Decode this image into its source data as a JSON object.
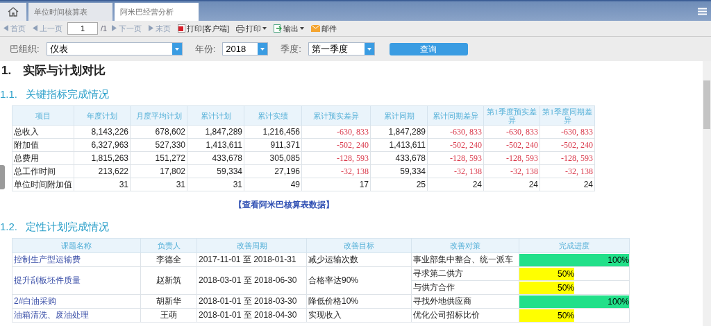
{
  "tabs": [
    {
      "label": "单位时间核算表",
      "selected": false
    },
    {
      "label": "阿米巴经营分析",
      "selected": true
    }
  ],
  "toolbar": [
    {
      "kind": "first",
      "label": "首页",
      "disabled": true
    },
    {
      "kind": "prev",
      "label": "上一页",
      "disabled": true
    },
    {
      "kind": "page",
      "value": "1",
      "total": "/1"
    },
    {
      "kind": "next",
      "label": "下一页",
      "disabled": true
    },
    {
      "kind": "last",
      "label": "末页",
      "disabled": true
    },
    {
      "kind": "pdf",
      "label": "打印[客户端]",
      "disabled": false
    },
    {
      "kind": "print",
      "label": "打印",
      "disabled": false
    },
    {
      "kind": "export",
      "label": "输出",
      "disabled": false
    },
    {
      "kind": "mail",
      "label": "邮件",
      "disabled": false
    }
  ],
  "filters": [
    {
      "label": "巴组织:",
      "value": "仪表"
    },
    {
      "label": "年份:",
      "value": "2018"
    },
    {
      "label": "季度:",
      "value": "第一季度"
    }
  ],
  "query_button": "查询",
  "heading": "1.　实际与计划对比",
  "section_1": {
    "number": "1.1.",
    "title": "关键指标完成情况",
    "columns": [
      {
        "label": "项目",
        "kind": "name"
      },
      {
        "label": "年度计划",
        "kind": "num"
      },
      {
        "label": "月度平均计划",
        "kind": "num"
      },
      {
        "label": "累计计划",
        "kind": "num"
      },
      {
        "label": "累计实绩",
        "kind": "num"
      },
      {
        "label": "累计预实差异",
        "kind": "diff"
      },
      {
        "label": "累计同期",
        "kind": "num"
      },
      {
        "label": "累计同期差异",
        "kind": "diff"
      },
      {
        "label": "第1季度预实差异",
        "kind": "diff"
      },
      {
        "label": "第1季度同期差异",
        "kind": "diff"
      }
    ],
    "rows": [
      [
        "总收入",
        "8,143,226",
        "678,602",
        "1,847,289",
        "1,216,456",
        "-630, 833",
        "1,847,289",
        "-630, 833",
        "-630, 833",
        "-630, 833"
      ],
      [
        "附加值",
        "6,327,963",
        "527,330",
        "1,413,611",
        "911,371",
        "-502, 240",
        "1,413,611",
        "-502, 240",
        "-502, 240",
        "-502, 240"
      ],
      [
        "总费用",
        "1,815,263",
        "151,272",
        "433,678",
        "305,085",
        "-128, 593",
        "433,678",
        "-128, 593",
        "-128, 593",
        "-128, 593"
      ],
      [
        "总工作时间",
        "213,622",
        "17,802",
        "59,334",
        "27,196",
        "-32, 138",
        "59,334",
        "-32, 138",
        "-32, 138",
        "-32, 138"
      ],
      [
        "单位时间附加值",
        "31",
        "31",
        "31",
        "49",
        "17",
        "25",
        "24",
        "24",
        "24"
      ]
    ],
    "link": "【查看阿米巴核算表数据】"
  },
  "section_2": {
    "number": "1.2.",
    "title": "定性计划完成情况",
    "columns": [
      "课题名称",
      "负责人",
      "改善周期",
      "改善目标",
      "改善对策",
      "完成进度"
    ],
    "rows": [
      {
        "topic": "控制生产型运输费",
        "owner": "李德全",
        "period": "2017-11-01 至 2018-01-31",
        "target": "减少运输次数",
        "measures": [
          {
            "text": "事业部集中整合、统一派车",
            "level": 1,
            "reading": "100%"
          }
        ]
      },
      {
        "topic": "提升刮板坯件质量",
        "owner": "赵新筑",
        "period": "2018-03-01 至 2018-06-30",
        "target": "合格率达90%",
        "measures": [
          {
            "text": "寻求第二供方",
            "level": 0.5,
            "reading": "50%"
          },
          {
            "text": "与供方合作",
            "level": 0.5,
            "reading": "50%"
          }
        ]
      },
      {
        "topic": "2#白油采购",
        "owner": "胡新华",
        "period": "2018-01-01 至 2018-03-30",
        "target": "降低价格10%",
        "measures": [
          {
            "text": "寻找外地供应商",
            "level": 1,
            "reading": "100%"
          }
        ]
      },
      {
        "topic": "油箱清洗、废油处理",
        "owner": "王萌",
        "period": "2018-01-01 至 2018-04-30",
        "target": "实现收入",
        "measures": [
          {
            "text": "优化公司招标比价",
            "level": 0.5,
            "reading": "50%"
          }
        ]
      }
    ]
  }
}
